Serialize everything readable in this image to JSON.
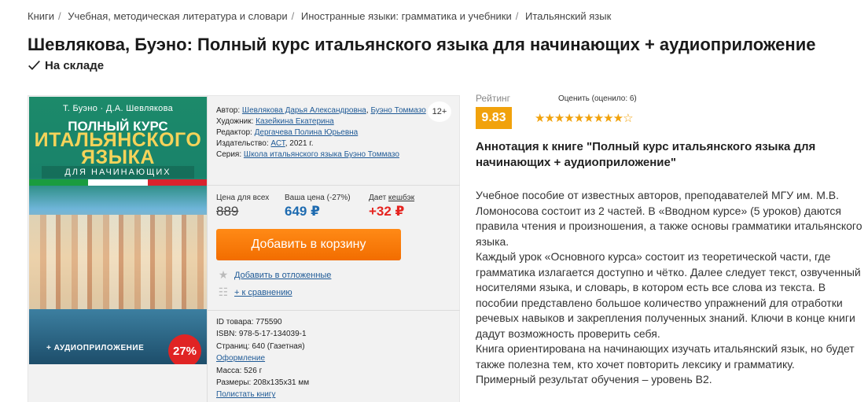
{
  "breadcrumbs": [
    "Книги",
    "Учебная, методическая литература и словари",
    "Иностранные языки: грамматика и учебники",
    "Итальянский язык"
  ],
  "title": "Шевлякова, Буэно: Полный курс итальянского языка для начинающих + аудиоприложение",
  "stock": "На складе",
  "cover": {
    "authors": "Т. Буэно · Д.А. Шевлякова",
    "title1": "ПОЛНЫЙ КУРС",
    "title2a": "ИТАЛЬЯНСКОГО",
    "title2b": "ЯЗЫКА",
    "title3": "ДЛЯ НАЧИНАЮЩИХ",
    "audio": "+ АУДИОПРИЛОЖЕНИЕ",
    "discount": "27%"
  },
  "age_badge": "12+",
  "info": {
    "author_label": "Автор:",
    "author_1": "Шевлякова Дарья Александровна",
    "author_2": "Буэно Томмазо",
    "artist_label": "Художник:",
    "artist": "Казейкина Екатерина",
    "editor_label": "Редактор:",
    "editor": "Дергачева Полина Юрьевна",
    "publisher_label": "Издательство:",
    "publisher": "АСТ",
    "year": ", 2021 г.",
    "series_label": "Серия:",
    "series": "Школа итальянского языка Буэно Томмазо"
  },
  "prices": {
    "all_label": "Цена для всех",
    "your_label": "Ваша цена (-27%)",
    "cash_label_prefix": "Дает ",
    "cash_label_link": "кешбэк",
    "old_price": "889",
    "price": "649 ₽",
    "cashback": "+32 ₽"
  },
  "add_to_cart": "Добавить в корзину",
  "wishlist": "Добавить в отложенные",
  "compare": "+ к сравнению",
  "details": {
    "id": "ID товара: 775590",
    "isbn": "ISBN: 978-5-17-134039-1",
    "pages": "Страниц: 640 (Газетная)",
    "design": "Оформление",
    "mass": "Масса: 526 г",
    "size": "Размеры: 208x135x31 мм",
    "flip": "Полистать книгу"
  },
  "rating": {
    "label": "Рейтинг",
    "value": "9.83",
    "rate_label": "Оценить (оценило: 6)",
    "stars": 9.5,
    "max": 10
  },
  "annotation": {
    "title": "Аннотация к книге \"Полный курс итальянского языка для начинающих + аудиоприложение\"",
    "p1": "Учебное пособие от известных авторов, преподавателей МГУ им. М.В. Ломоносова состоит из 2 частей. В «Вводном курсе» (5 уроков) даются правила чтения и произношения, а также основы грамматики итальянского языка.",
    "p2": "Каждый урок «Основного курса» состоит из теоретической части, где грамматика излагается доступно и чётко. Далее следует текст, озвученный носителями языка, и словарь, в котором есть все слова из текста. В пособии представлено большое количество упражнений для отработки речевых навыков и закрепления полученных знаний. Ключи в конце книги дадут возможность проверить себя.",
    "p3": "Книга ориентирована на начинающих изучать итальянский язык, но будет также полезна тем, кто хочет повторить лексику и грамматику.",
    "p4": "Примерный результат обучения – уровень B2."
  },
  "colors": {
    "accent_orange": "#f26d00",
    "link": "#1f5a96",
    "rating": "#f1a20c",
    "price_blue": "#1e6bb0",
    "red": "#e52420"
  }
}
